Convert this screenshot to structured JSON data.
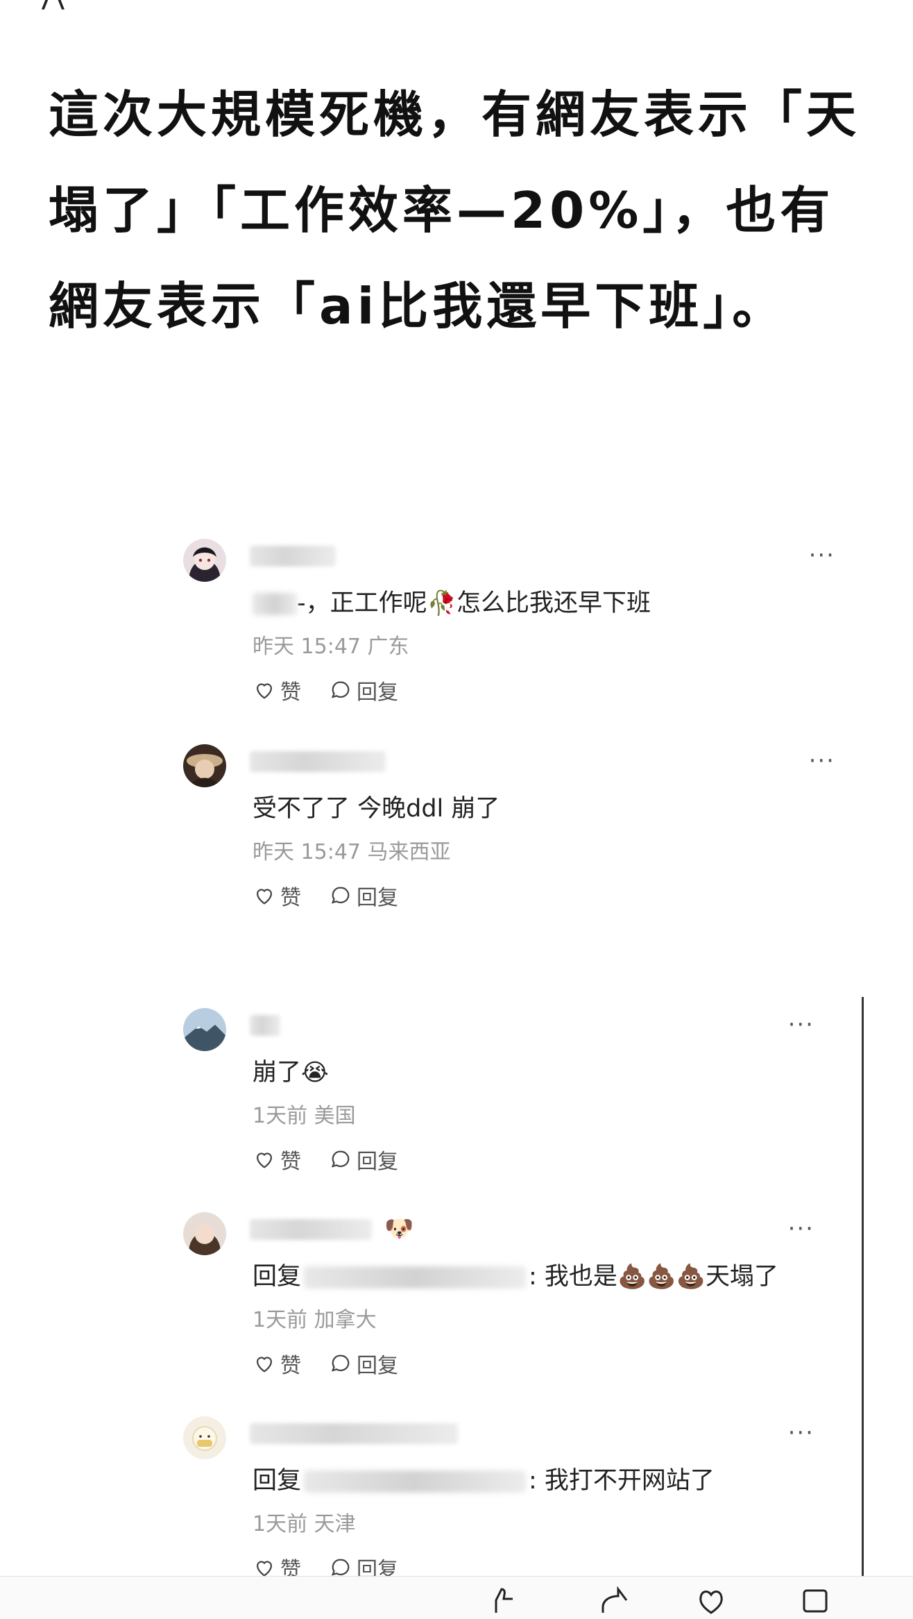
{
  "headline": "這次大規模死機，有網友表示「天塌了」「工作效率—20%」，也有網友表示「ai比我還早下班」。",
  "comments": [
    {
      "body_prefix": "-，",
      "body_text": "正工作呢",
      "body_emoji": "🥀",
      "body_suffix": "怎么比我还早下班",
      "meta": "昨天 15:47 广东",
      "like_label": "赞",
      "reply_label": "回复",
      "more": "···"
    },
    {
      "body_text": "受不了了 今晚ddl 崩了",
      "meta": "昨天 15:47 马来西亚",
      "like_label": "赞",
      "reply_label": "回复",
      "more": "···"
    },
    {
      "body_text": "崩了",
      "body_emoji": "😭",
      "meta": "1天前 美国",
      "like_label": "赞",
      "reply_label": "回复",
      "more": "···"
    },
    {
      "name_emoji": "🐶",
      "reply_prefix": "回复",
      "body_text": ": 我也是",
      "body_emoji": "💩💩💩",
      "body_suffix": "天塌了",
      "meta": "1天前 加拿大",
      "like_label": "赞",
      "reply_label": "回复",
      "more": "···"
    },
    {
      "reply_prefix": "回复",
      "body_text": ": 我打不开网站了",
      "meta": "1天前 天津",
      "like_label": "赞",
      "reply_label": "回复",
      "more": "···"
    }
  ],
  "icons": {
    "like": "heart-icon",
    "reply": "chat-bubble-icon",
    "more": "more-dots-icon"
  }
}
